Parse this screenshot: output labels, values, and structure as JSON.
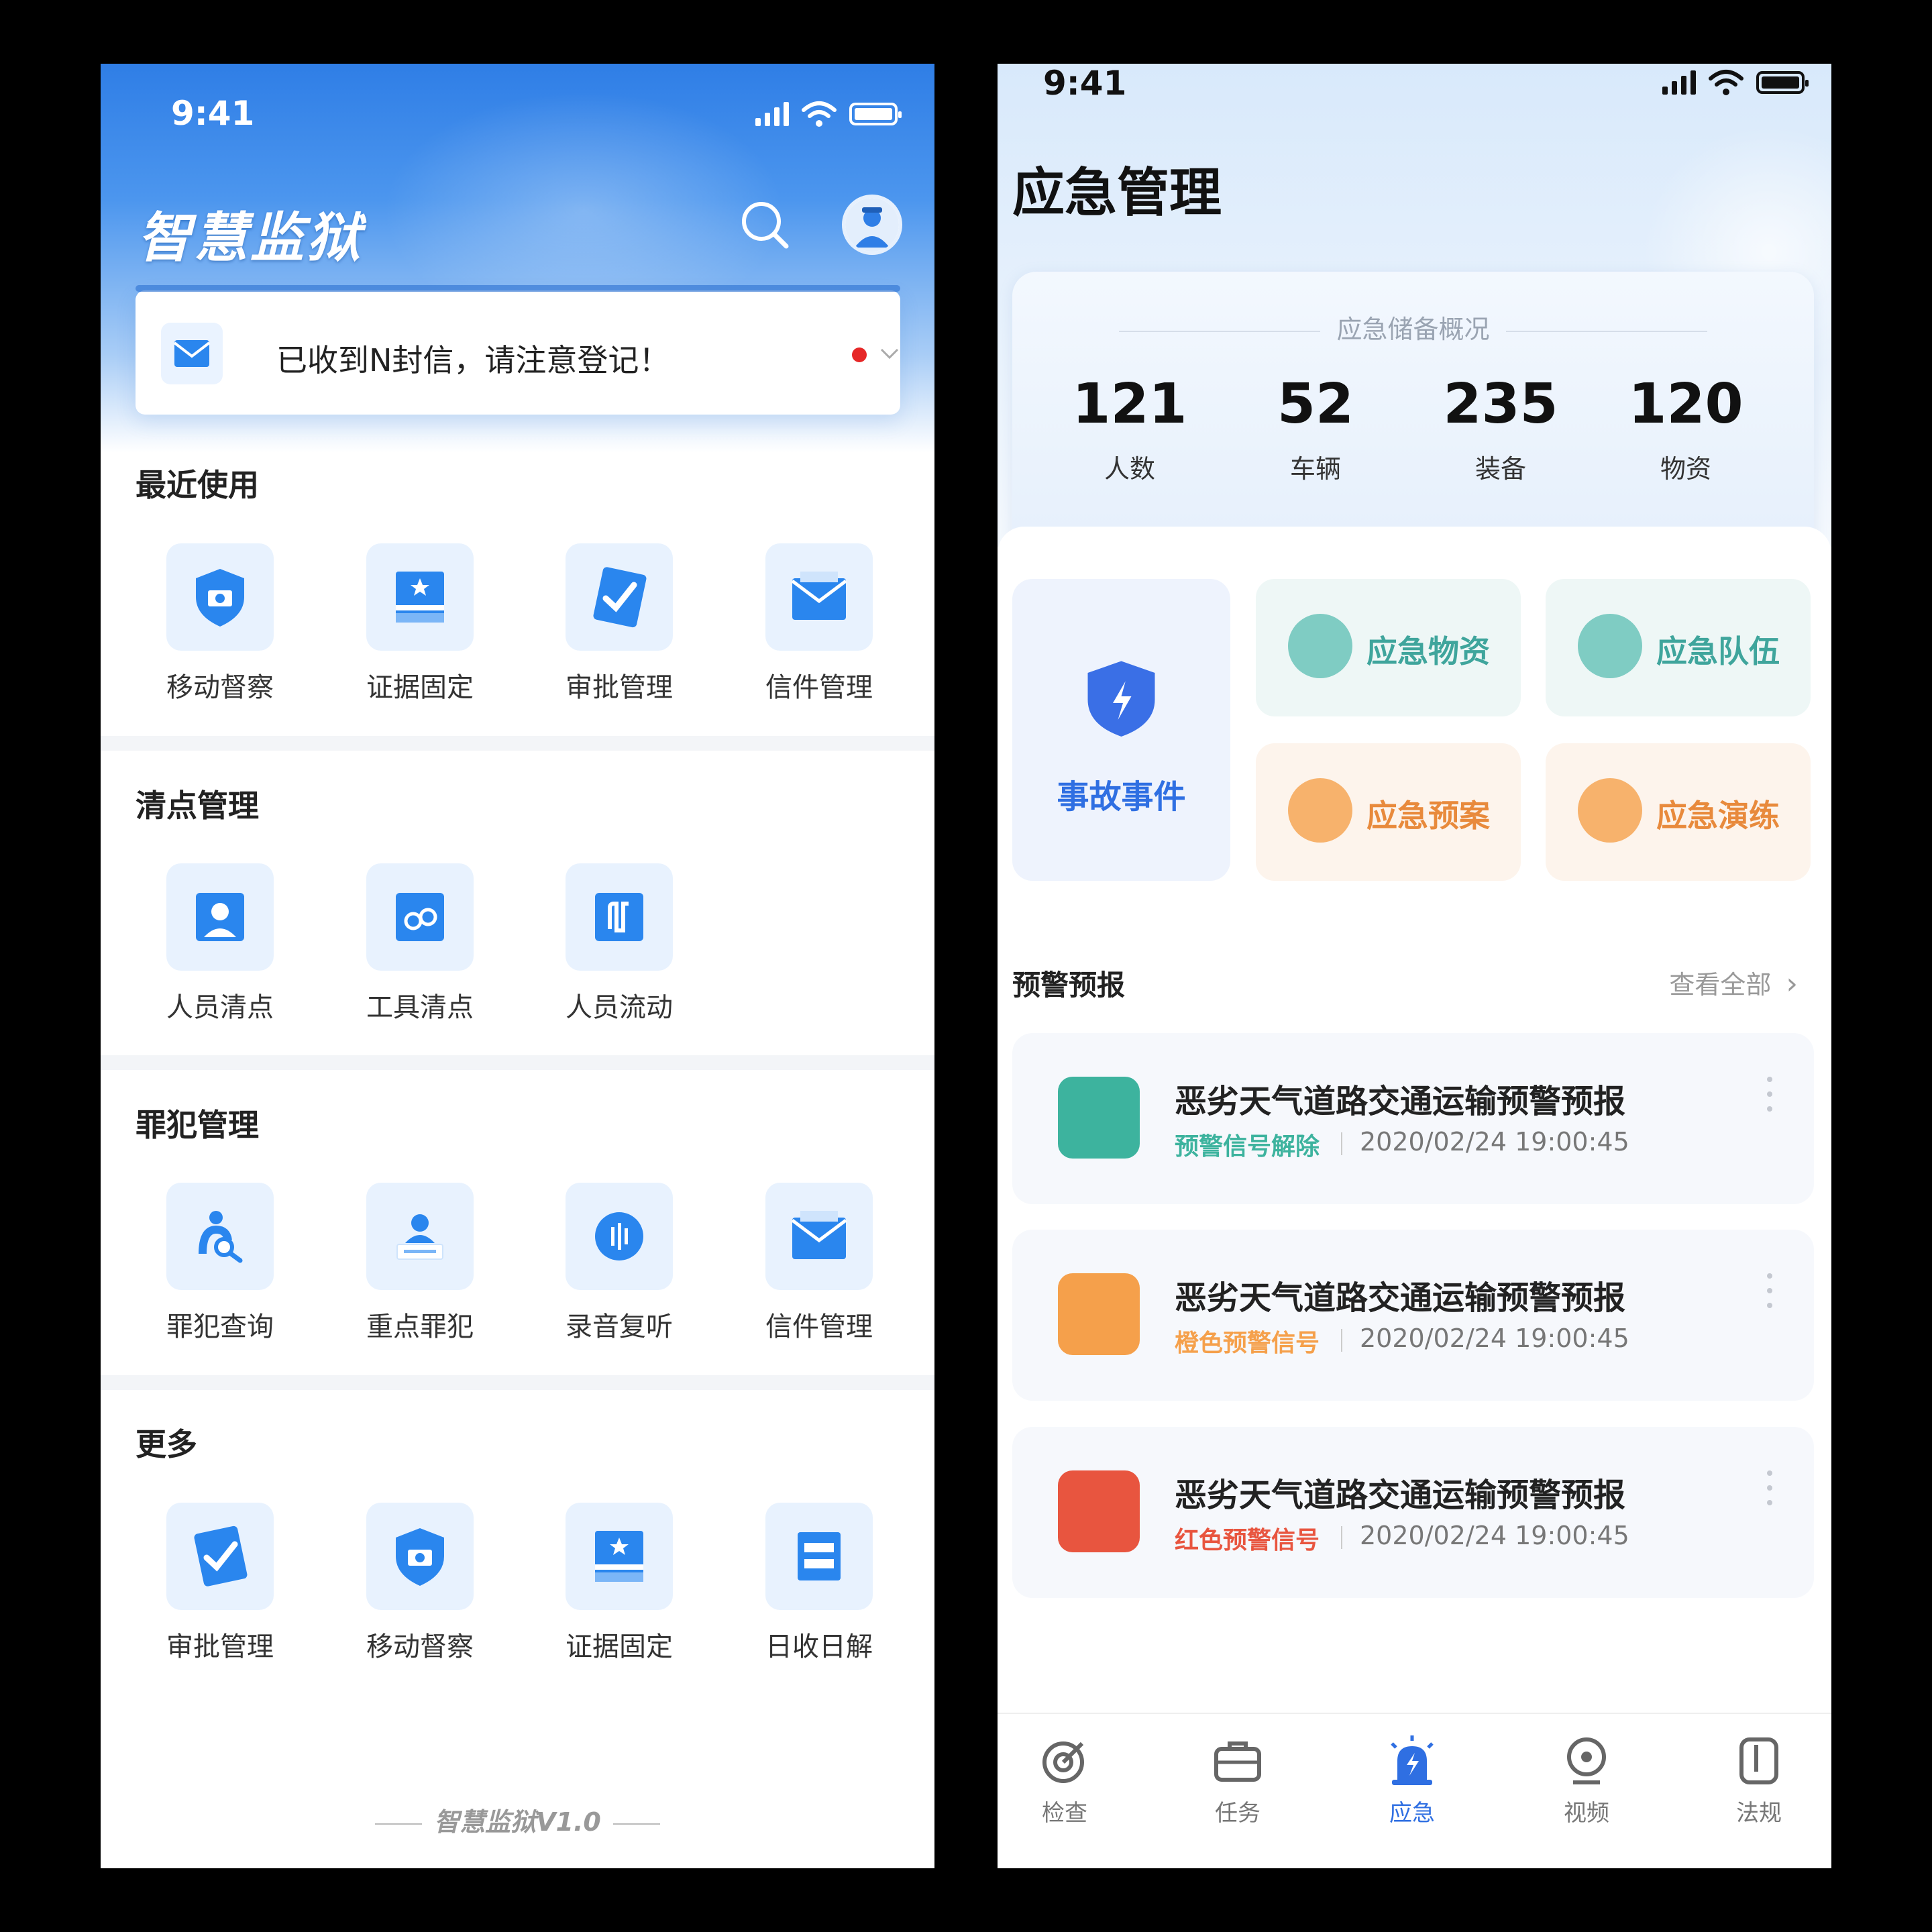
{
  "phoneA": {
    "status_time": "9:41",
    "app_title": "智慧监狱",
    "notice": {
      "text": "已收到N封信，请注意登记！"
    },
    "sections": [
      {
        "title": "最近使用",
        "items": [
          "移动督察",
          "证据固定",
          "审批管理",
          "信件管理"
        ]
      },
      {
        "title": "清点管理",
        "items": [
          "人员清点",
          "工具清点",
          "人员流动"
        ]
      },
      {
        "title": "罪犯管理",
        "items": [
          "罪犯查询",
          "重点罪犯",
          "录音复听",
          "信件管理"
        ]
      },
      {
        "title": "更多",
        "items": [
          "审批管理",
          "移动督察",
          "证据固定",
          "日收日解"
        ]
      }
    ],
    "footer": "智慧监狱V1.0"
  },
  "phoneB": {
    "status_time": "9:41",
    "page_title": "应急管理",
    "reserve": {
      "title": "应急储备概况",
      "stats": [
        {
          "value": "121",
          "label": "人数"
        },
        {
          "value": "52",
          "label": "车辆"
        },
        {
          "value": "235",
          "label": "装备"
        },
        {
          "value": "120",
          "label": "物资"
        }
      ]
    },
    "quick": {
      "main": "事故事件",
      "items": [
        "应急物资",
        "应急队伍",
        "应急预案",
        "应急演练"
      ]
    },
    "warnings": {
      "title": "预警预报",
      "view_all": "查看全部",
      "items": [
        {
          "title": "恶劣天气道路交通运输预警预报",
          "status": "预警信号解除",
          "time": "2020/02/24  19:00:45",
          "color": "#3db39e"
        },
        {
          "title": "恶劣天气道路交通运输预警预报",
          "status": "橙色预警信号",
          "time": "2020/02/24  19:00:45",
          "color": "#f5a04b"
        },
        {
          "title": "恶劣天气道路交通运输预警预报",
          "status": "红色预警信号",
          "time": "2020/02/24  19:00:45",
          "color": "#e8553f"
        }
      ]
    },
    "tabs": [
      {
        "label": "检查",
        "icon": "target-icon"
      },
      {
        "label": "任务",
        "icon": "briefcase-icon"
      },
      {
        "label": "应急",
        "icon": "alarm-icon",
        "active": true
      },
      {
        "label": "视频",
        "icon": "webcam-icon"
      },
      {
        "label": "法规",
        "icon": "book-icon"
      }
    ]
  }
}
